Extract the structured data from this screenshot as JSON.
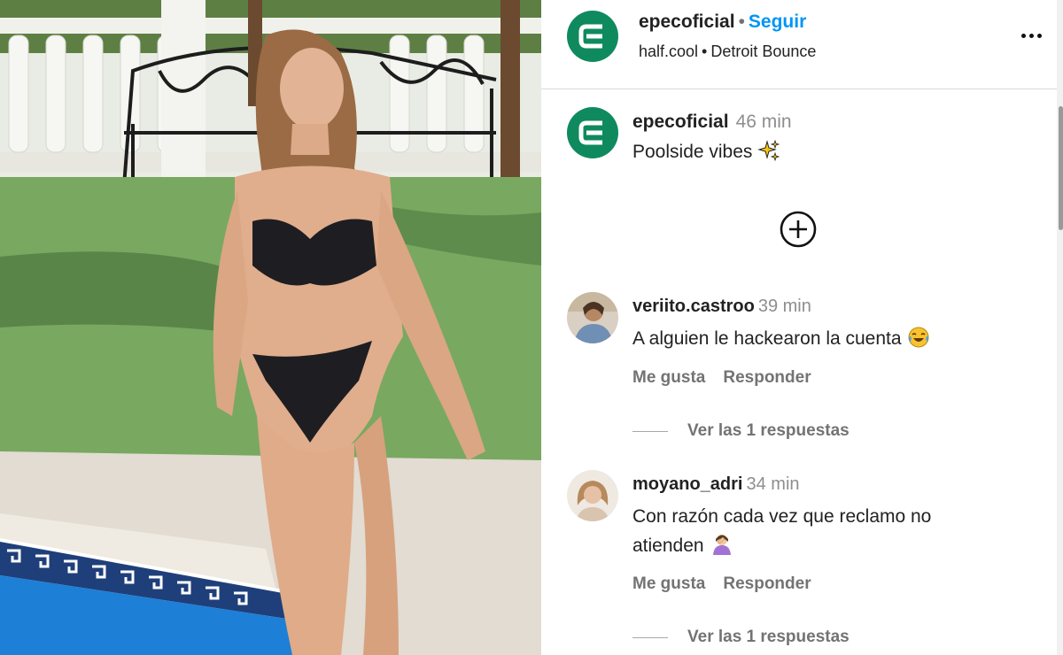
{
  "post": {
    "username": "epecoficial",
    "separator": "•",
    "follow_label": "Seguir",
    "audio_artist": "half.cool",
    "audio_title": "Detroit Bounce",
    "caption_user": "epecoficial",
    "caption_time": "46 min",
    "caption_text": "Poolside vibes"
  },
  "comments": [
    {
      "user": "veriito.castroo",
      "time": "39 min",
      "text": "A alguien le hackearon la cuenta",
      "like_label": "Me gusta",
      "reply_label": "Responder",
      "replies_label": "Ver las 1 respuestas"
    },
    {
      "user": "moyano_adri",
      "time": "34 min",
      "text": "Con razón cada vez que reclamo no atienden",
      "like_label": "Me gusta",
      "reply_label": "Responder",
      "replies_label": "Ver las 1 respuestas"
    }
  ],
  "icons": {
    "logo": "epec-logo-icon",
    "more": "more-options-icon",
    "add": "add-comment-icon",
    "sparkle": "sparkles-emoji",
    "laugh": "tears-of-joy-emoji",
    "facepalm": "facepalm-emoji"
  },
  "colors": {
    "brand_green": "#0f8a5f",
    "follow_blue": "#0095f6",
    "muted": "#8e8e8e"
  }
}
